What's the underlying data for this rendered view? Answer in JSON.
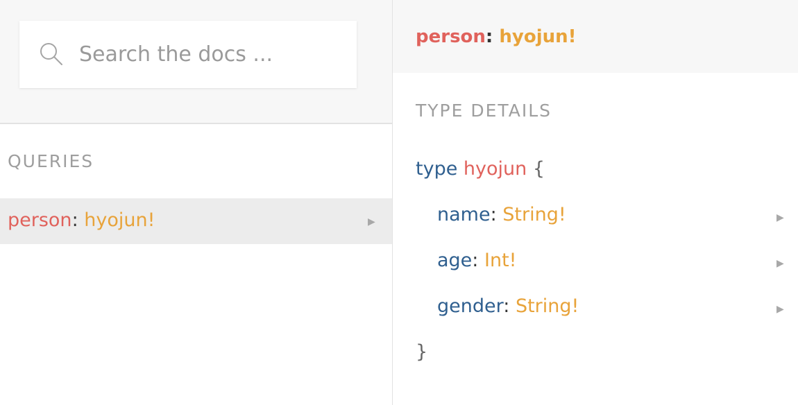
{
  "search": {
    "placeholder": "Search the docs ...",
    "icon": "search-icon"
  },
  "queries": {
    "title": "QUERIES",
    "items": [
      {
        "name": "person",
        "colon": ":",
        "type": "hyojun!"
      }
    ]
  },
  "doc": {
    "header": {
      "name": "person",
      "colon": ":",
      "type": "hyojun!"
    },
    "section_title": "TYPE DETAILS",
    "type_keyword": "type",
    "type_name": "hyojun",
    "open_brace": "{",
    "close_brace": "}",
    "fields": [
      {
        "name": "name",
        "colon": ":",
        "type": "String!"
      },
      {
        "name": "age",
        "colon": ":",
        "type": "Int!"
      },
      {
        "name": "gender",
        "colon": ":",
        "type": "String!"
      }
    ]
  },
  "colors": {
    "field": "#e0625c",
    "type": "#e8a33a",
    "keyword": "#2f5f8f",
    "section_title": "#9e9e9e",
    "selected_row": "#ececec"
  }
}
